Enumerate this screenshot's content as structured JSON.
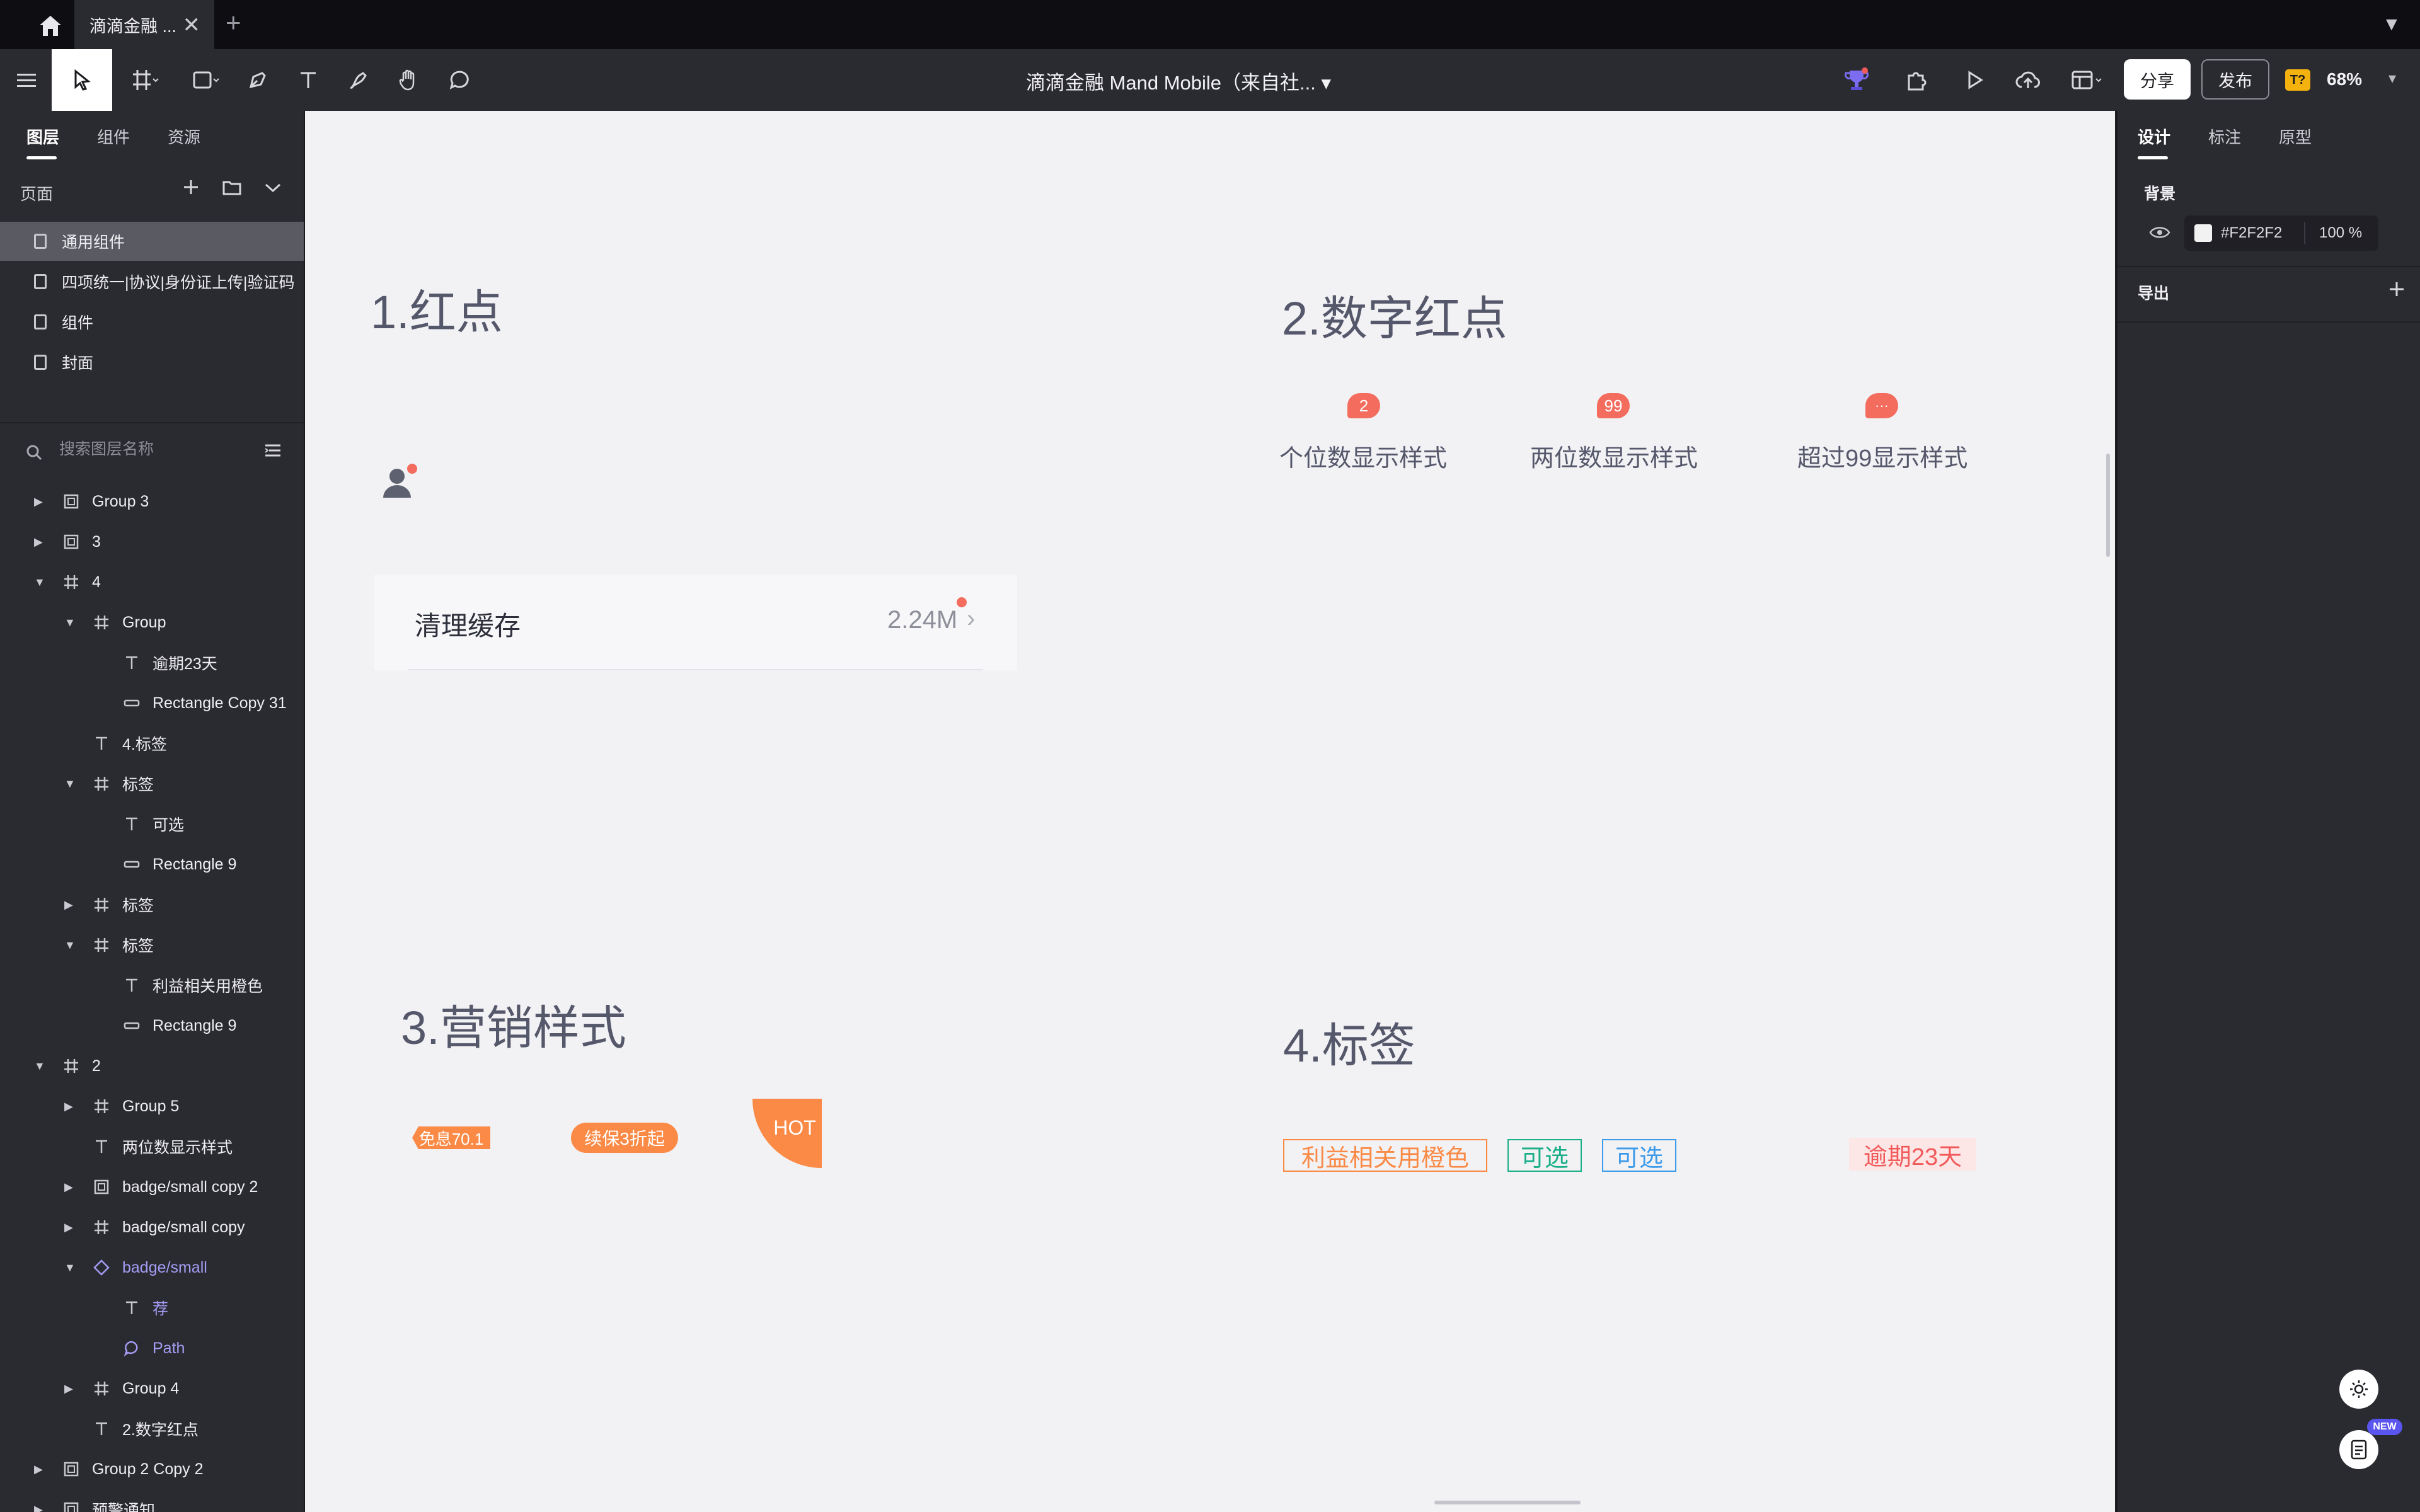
{
  "titlebar": {
    "tab_label": "滴滴金融 ...",
    "close_glyph": "✕",
    "new_tab_glyph": "+"
  },
  "toolbar": {
    "doc_title": "滴滴金融 Mand Mobile（来自社... ▾",
    "share_label": "分享",
    "publish_label": "发布",
    "badge_label": "T?",
    "zoom": "68%"
  },
  "left_panel": {
    "tabs": [
      "图层",
      "组件",
      "资源"
    ],
    "pages_header": "页面",
    "pages": [
      "通用组件",
      "四项统一|协议|身份证上传|验证码",
      "组件",
      "封面"
    ],
    "selected_page": 0,
    "search_placeholder": "搜索图层名称",
    "layers": [
      {
        "name": "Group 3",
        "icon": "symbol",
        "depth": 0,
        "arrow": "right"
      },
      {
        "name": "3",
        "icon": "symbol",
        "depth": 0,
        "arrow": "right"
      },
      {
        "name": "4",
        "icon": "frame",
        "depth": 0,
        "arrow": "down"
      },
      {
        "name": "Group",
        "icon": "frame",
        "depth": 1,
        "arrow": "down"
      },
      {
        "name": "逾期23天",
        "icon": "text",
        "depth": 2,
        "arrow": ""
      },
      {
        "name": "Rectangle Copy 31",
        "icon": "rect",
        "depth": 2,
        "arrow": ""
      },
      {
        "name": "4.标签",
        "icon": "text",
        "depth": 1,
        "arrow": ""
      },
      {
        "name": "标签",
        "icon": "frame",
        "depth": 1,
        "arrow": "down"
      },
      {
        "name": "可选",
        "icon": "text",
        "depth": 2,
        "arrow": ""
      },
      {
        "name": "Rectangle 9",
        "icon": "rect",
        "depth": 2,
        "arrow": ""
      },
      {
        "name": "标签",
        "icon": "frame",
        "depth": 1,
        "arrow": "right"
      },
      {
        "name": "标签",
        "icon": "frame",
        "depth": 1,
        "arrow": "down"
      },
      {
        "name": "利益相关用橙色",
        "icon": "text",
        "depth": 2,
        "arrow": ""
      },
      {
        "name": "Rectangle 9",
        "icon": "rect",
        "depth": 2,
        "arrow": ""
      },
      {
        "name": "2",
        "icon": "frame",
        "depth": 0,
        "arrow": "down"
      },
      {
        "name": "Group 5",
        "icon": "frame",
        "depth": 1,
        "arrow": "right"
      },
      {
        "name": "两位数显示样式",
        "icon": "text",
        "depth": 1,
        "arrow": ""
      },
      {
        "name": "badge/small copy 2",
        "icon": "symbol",
        "depth": 1,
        "arrow": "right"
      },
      {
        "name": "badge/small copy",
        "icon": "frame",
        "depth": 1,
        "arrow": "right"
      },
      {
        "name": "badge/small",
        "icon": "component",
        "depth": 1,
        "arrow": "down",
        "comp": true
      },
      {
        "name": "荐",
        "icon": "text",
        "depth": 2,
        "arrow": "",
        "comp": true
      },
      {
        "name": "Path",
        "icon": "path",
        "depth": 2,
        "arrow": "",
        "comp": true
      },
      {
        "name": "Group 4",
        "icon": "frame",
        "depth": 1,
        "arrow": "right"
      },
      {
        "name": "2.数字红点",
        "icon": "text",
        "depth": 1,
        "arrow": ""
      },
      {
        "name": "Group 2 Copy 2",
        "icon": "symbol",
        "depth": 0,
        "arrow": "right"
      },
      {
        "name": "预警通知",
        "icon": "symbol",
        "depth": 0,
        "arrow": "right"
      }
    ]
  },
  "canvas": {
    "background": "#F2F2F5",
    "section1": {
      "title": "1.红点",
      "list_title": "清理缓存",
      "list_value": "2.24M",
      "chevron": "›"
    },
    "section2": {
      "title": "2.数字红点",
      "badges": [
        {
          "label": "2",
          "caption": "个位数显示样式"
        },
        {
          "label": "99",
          "caption": "两位数显示样式"
        },
        {
          "label": "···",
          "caption": "超过99显示样式"
        }
      ]
    },
    "section3": {
      "title": "3.营销样式",
      "items": [
        "免息70.1",
        "续保3折起",
        "HOT"
      ]
    },
    "section4": {
      "title": "4.标签",
      "tags": [
        {
          "label": "利益相关用橙色",
          "color": "#FA8A46"
        },
        {
          "label": "可选",
          "color": "#1AAF88"
        },
        {
          "label": "可选",
          "color": "#3D9BE9"
        },
        {
          "label": "逾期23天",
          "color": "#F25A5A"
        }
      ]
    },
    "badge_color": "#F36C5E",
    "marketing_color": "#FA8A46"
  },
  "right_panel": {
    "tabs": [
      "设计",
      "标注",
      "原型"
    ],
    "background_label": "背景",
    "fill_hex": "#F2F2F2",
    "fill_opacity": "100 %",
    "export_label": "导出",
    "new_badge": "NEW"
  }
}
